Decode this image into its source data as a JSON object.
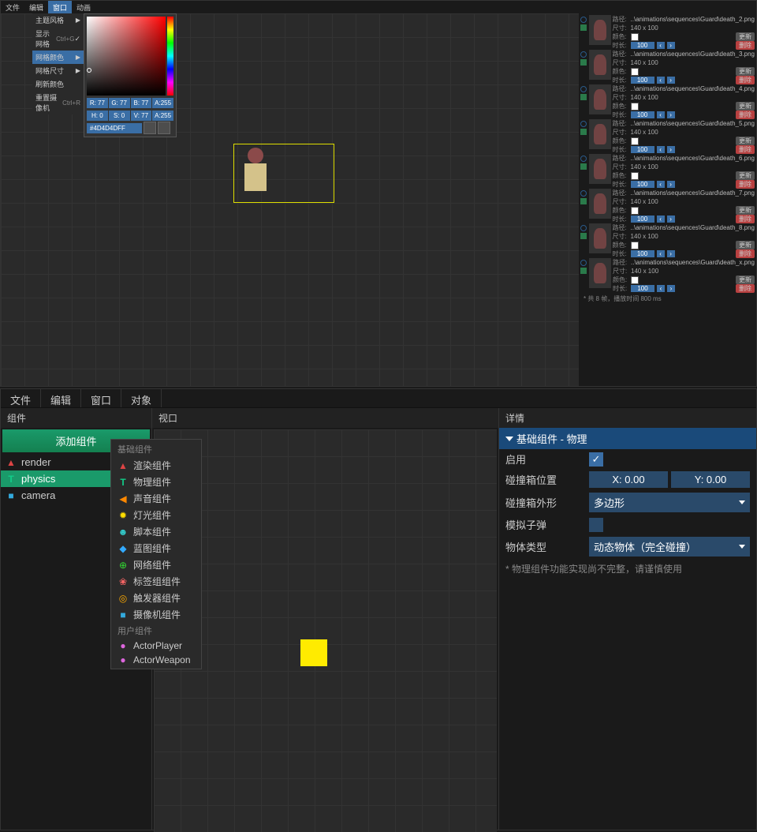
{
  "top": {
    "menu": [
      "文件",
      "编辑",
      "窗口",
      "动画"
    ],
    "menu_active": "窗口",
    "submenu": [
      {
        "label": "主题风格",
        "arrow": true
      },
      {
        "label": "显示网格",
        "shortcut": "Ctrl+G",
        "check": true
      },
      {
        "label": "网格颜色",
        "arrow": true,
        "highlight": true
      },
      {
        "label": "网格尺寸",
        "arrow": true
      },
      {
        "label": "刷新颜色"
      },
      {
        "label": "重置摄像机",
        "shortcut": "Ctrl+R"
      }
    ],
    "color": {
      "r": "R: 77",
      "g": "G: 77",
      "b": "B: 77",
      "a": "A:255",
      "h": "H: 0",
      "s": "S: 0",
      "v": "V: 77",
      "a2": "A:255",
      "hex": "#4D4D4DFF"
    },
    "frames": [
      {
        "path": "..\\animations\\sequences\\Guard\\death_2.png"
      },
      {
        "path": "..\\animations\\sequences\\Guard\\death_3.png"
      },
      {
        "path": "..\\animations\\sequences\\Guard\\death_4.png"
      },
      {
        "path": "..\\animations\\sequences\\Guard\\death_5.png"
      },
      {
        "path": "..\\animations\\sequences\\Guard\\death_6.png"
      },
      {
        "path": "..\\animations\\sequences\\Guard\\death_7.png"
      },
      {
        "path": "..\\animations\\sequences\\Guard\\death_8.png"
      },
      {
        "path": "..\\animations\\sequences\\Guard\\death_x.png"
      }
    ],
    "frame_labels": {
      "path": "路径:",
      "size": "尺寸:",
      "size_val": "140 x 100",
      "color": "颜色:",
      "btn_update": "更新",
      "duration": "时长:",
      "dur_val": "100",
      "btn_delete": "删除"
    },
    "footer": "* 共 8 帧，播放时间 800 ms"
  },
  "bottom": {
    "menu": [
      "文件",
      "编辑",
      "窗口",
      "对象"
    ],
    "panels": {
      "left": "组件",
      "mid": "视口",
      "right": "详情"
    },
    "add_btn": "添加组件",
    "complist": [
      {
        "name": "render",
        "icon": "▲",
        "cls": "ico-render"
      },
      {
        "name": "physics",
        "icon": "T",
        "cls": "ico-phys",
        "sel": true
      },
      {
        "name": "camera",
        "icon": "■",
        "cls": "ico-cam"
      }
    ],
    "popup": {
      "hdr1": "基础组件",
      "items1": [
        {
          "label": "渲染组件",
          "icon": "▲",
          "cls": "ico-render"
        },
        {
          "label": "物理组件",
          "icon": "T",
          "cls": "ico-phys"
        },
        {
          "label": "声音组件",
          "icon": "◀",
          "cls": "ico-sound"
        },
        {
          "label": "灯光组件",
          "icon": "✹",
          "cls": "ico-light"
        },
        {
          "label": "脚本组件",
          "icon": "☻",
          "cls": "ico-script"
        },
        {
          "label": "蓝图组件",
          "icon": "◆",
          "cls": "ico-blue"
        },
        {
          "label": "网络组件",
          "icon": "⊕",
          "cls": "ico-net"
        },
        {
          "label": "标签组组件",
          "icon": "❀",
          "cls": "ico-tag"
        },
        {
          "label": "触发器组件",
          "icon": "◎",
          "cls": "ico-trig"
        },
        {
          "label": "摄像机组件",
          "icon": "■",
          "cls": "ico-cam"
        }
      ],
      "hdr2": "用户组件",
      "items2": [
        {
          "label": "ActorPlayer",
          "icon": "●",
          "cls": "ico-user"
        },
        {
          "label": "ActorWeapon",
          "icon": "●",
          "cls": "ico-user"
        }
      ]
    },
    "details": {
      "header": "基础组件 - 物理",
      "enable": "启用",
      "hitpos": "碰撞箱位置",
      "x": "X: 0.00",
      "y": "Y: 0.00",
      "shape": "碰撞箱外形",
      "shape_val": "多边形",
      "bullet": "模拟子弹",
      "bodytype": "物体类型",
      "bodytype_val": "动态物体（完全碰撞）",
      "note": "* 物理组件功能实现尚不完整，请谨慎使用"
    }
  }
}
